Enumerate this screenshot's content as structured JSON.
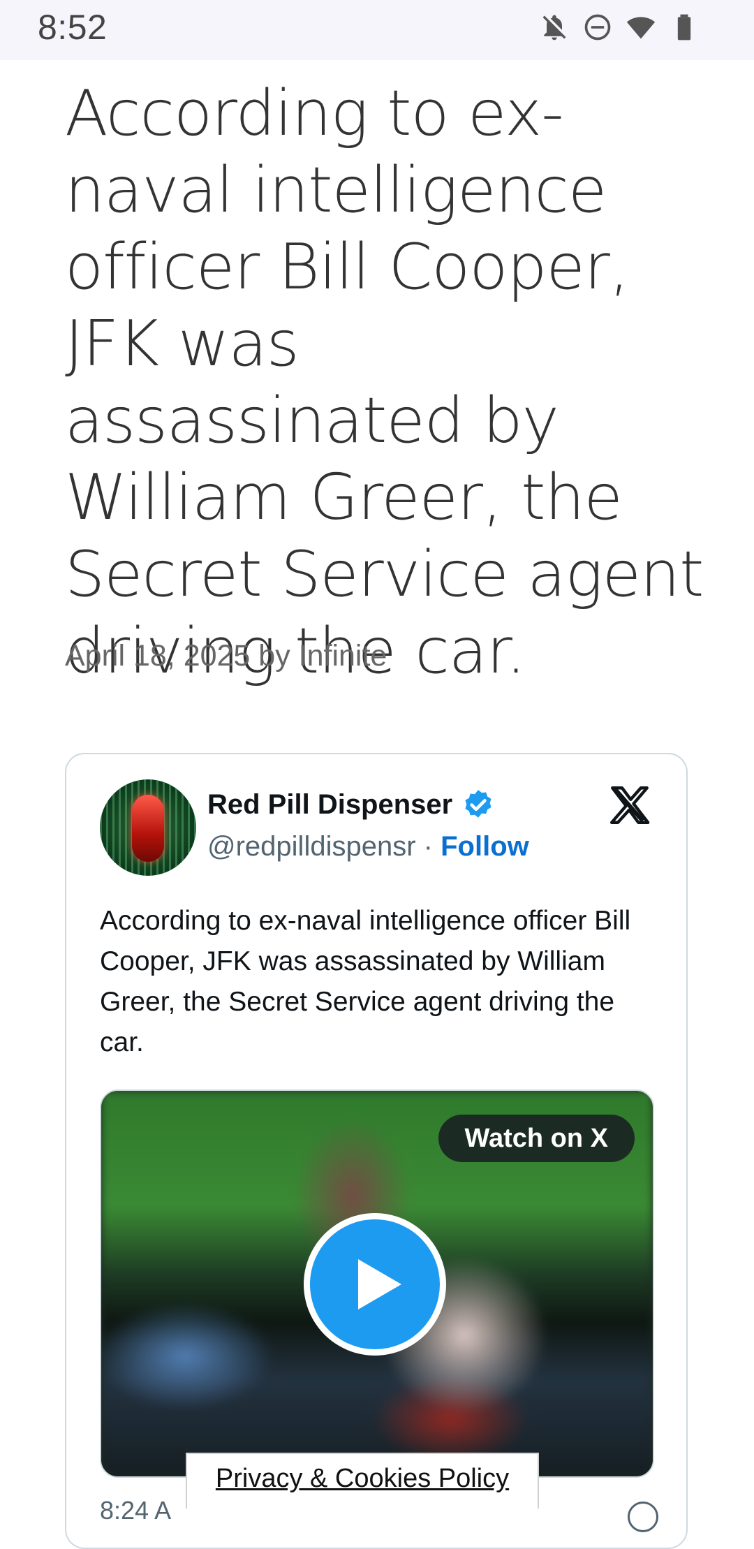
{
  "status_bar": {
    "time": "8:52",
    "icons": [
      "notifications-off-icon",
      "do-not-disturb-icon",
      "wifi-icon",
      "battery-icon"
    ]
  },
  "article": {
    "title": "According to ex-naval intelligence officer Bill Cooper, JFK was assassinated by William Greer, the Secret Service agent driving the car.",
    "byline": "April 18, 2025 by Infinite"
  },
  "tweet": {
    "author_name": "Red Pill Dispenser",
    "handle": "@redpilldispensr",
    "separator": "·",
    "follow_label": "Follow",
    "text": "According to ex-naval intelligence officer Bill Cooper, JFK was assassinated by William Greer, the Secret Service agent driving the car.",
    "video": {
      "watch_label": "Watch on X"
    },
    "timestamp_peek": "8:24 A"
  },
  "privacy_banner": {
    "label": "Privacy & Cookies Policy"
  },
  "colors": {
    "accent_blue": "#1d9bf0",
    "follow_blue": "#0a6fd1",
    "title_text": "#333333"
  }
}
